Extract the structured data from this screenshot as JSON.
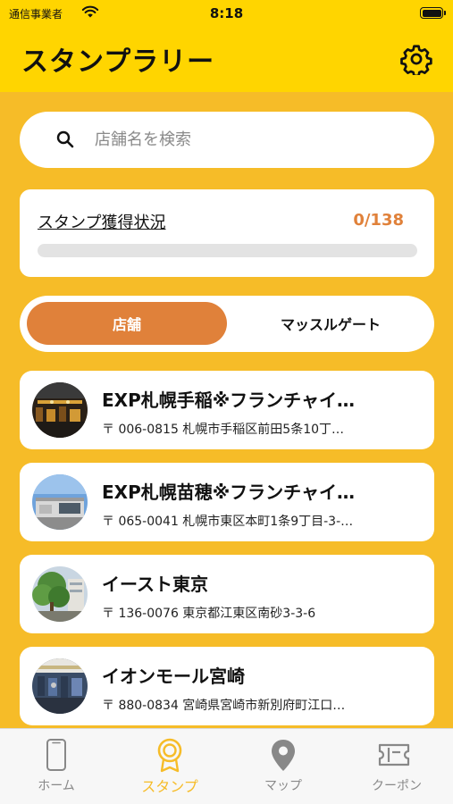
{
  "status_bar": {
    "carrier": "通信事業者",
    "time": "8:18"
  },
  "header": {
    "title": "スタンプラリー",
    "settings_icon": "gear-icon"
  },
  "search": {
    "placeholder": "店舗名を検索",
    "value": "",
    "icon": "search-icon"
  },
  "progress": {
    "label": "スタンプ獲得状況",
    "count_text": "0/138",
    "acquired": 0,
    "total": 138,
    "accent_color": "#E0813A"
  },
  "segment": {
    "tabs": [
      {
        "label": "店舗",
        "active": true
      },
      {
        "label": "マッスルゲート",
        "active": false
      }
    ]
  },
  "stores": [
    {
      "name": "EXP札幌手稲※フランチャイ…",
      "address": "〒 006-0815 札幌市手稲区前田5条10丁…",
      "thumb": "gym-interior-photo"
    },
    {
      "name": "EXP札幌苗穂※フランチャイ…",
      "address": "〒 065-0041 札幌市東区本町1条9丁目-3-…",
      "thumb": "building-exterior-photo"
    },
    {
      "name": "イースト東京",
      "address": "〒 136-0076 東京都江東区南砂3-3-6",
      "thumb": "tree-building-photo"
    },
    {
      "name": "イオンモール宮崎",
      "address": "〒 880-0834 宮崎県宮崎市新別府町江口…",
      "thumb": "gym-floor-photo"
    }
  ],
  "tabbar": {
    "items": [
      {
        "label": "ホーム",
        "icon": "phone-icon",
        "active": false
      },
      {
        "label": "スタンプ",
        "icon": "medal-icon",
        "active": true
      },
      {
        "label": "マップ",
        "icon": "map-pin-icon",
        "active": false
      },
      {
        "label": "クーポン",
        "icon": "ticket-icon",
        "active": false
      }
    ]
  },
  "colors": {
    "header_bg": "#FFD500",
    "page_bg": "#F6BC28",
    "accent": "#E0813A"
  }
}
